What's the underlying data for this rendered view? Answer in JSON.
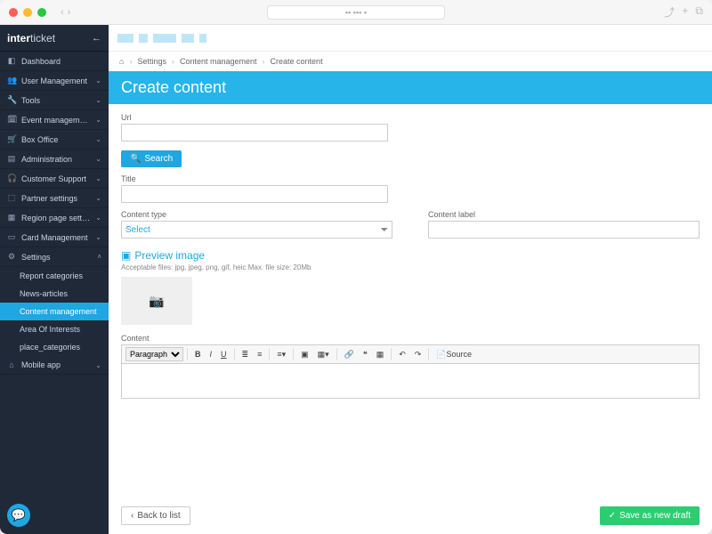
{
  "brand": {
    "strong": "inter",
    "light": "ticket"
  },
  "sidebar": {
    "items": [
      {
        "icon": "◧",
        "label": "Dashboard",
        "chev": ""
      },
      {
        "icon": "👥",
        "label": "User Management",
        "chev": "⌄"
      },
      {
        "icon": "🔧",
        "label": "Tools",
        "chev": "⌄"
      },
      {
        "icon": "🗓",
        "label": "Event management",
        "chev": "⌄"
      },
      {
        "icon": "🛒",
        "label": "Box Office",
        "chev": "⌄"
      },
      {
        "icon": "▤",
        "label": "Administration",
        "chev": "⌄"
      },
      {
        "icon": "🎧",
        "label": "Customer Support",
        "chev": "⌄"
      },
      {
        "icon": "⬚",
        "label": "Partner settings",
        "chev": "⌄"
      },
      {
        "icon": "▦",
        "label": "Region page settings",
        "chev": "⌄"
      },
      {
        "icon": "▭",
        "label": "Card Management",
        "chev": "⌄"
      }
    ],
    "settings": {
      "icon": "⚙",
      "label": "Settings",
      "chev": "˄"
    },
    "subs": [
      "Report categories",
      "News-articles",
      "Content management",
      "Area Of Interests",
      "place_categories"
    ],
    "mobile": {
      "icon": "⌂",
      "label": "Mobile app",
      "chev": "⌄"
    }
  },
  "breadcrumbs": [
    "Settings",
    "Content management",
    "Create content"
  ],
  "page_title": "Create content",
  "labels": {
    "url": "Url",
    "search": "Search",
    "title": "Title",
    "content_type": "Content type",
    "content_label": "Content label",
    "select": "Select",
    "preview": "Preview image",
    "accept": "Acceptable files: jpg, jpeg, png, gif, heic Max. file size: 20Mb",
    "content": "Content",
    "paragraph": "Paragraph",
    "source": "Source",
    "back": "Back to list",
    "save": "Save as new draft"
  }
}
